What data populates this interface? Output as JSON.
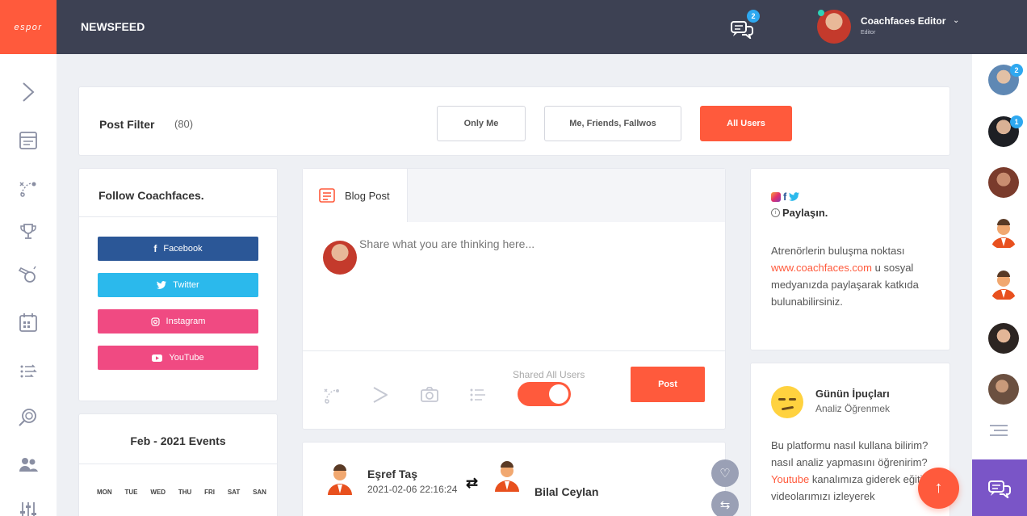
{
  "brand": {
    "logo_text": "espor",
    "accent": "#ff5a3c"
  },
  "header": {
    "title": "NEWSFEED",
    "messages_badge": "2",
    "user": {
      "name": "Coachfaces Editor",
      "role": "Editor"
    }
  },
  "left_nav": [
    "chevron-right-icon",
    "newsfeed-icon",
    "tactics-icon",
    "trophy-icon",
    "whistle-icon",
    "calendar-icon",
    "drills-icon",
    "analysis-icon",
    "team-icon",
    "settings-sliders-icon"
  ],
  "right_sidebar": {
    "badges": [
      "2",
      "1"
    ]
  },
  "post_filter": {
    "label": "Post Filter",
    "count": "(80)",
    "options": [
      "Only Me",
      "Me, Friends, Fallwos",
      "All Users"
    ],
    "active": "All Users"
  },
  "follow": {
    "title": "Follow Coachfaces.",
    "buttons": [
      {
        "label": "Facebook",
        "color": "#2b5797"
      },
      {
        "label": "Twitter",
        "color": "#2bb9ec"
      },
      {
        "label": "Instagram",
        "color": "#f04a82"
      },
      {
        "label": "YouTube",
        "color": "#f04a82"
      }
    ]
  },
  "events": {
    "title": "Feb - 2021 Events",
    "days": [
      "MON",
      "TUE",
      "WED",
      "THU",
      "FRI",
      "SAT",
      "SAN"
    ]
  },
  "composer": {
    "tab_label": "Blog Post",
    "placeholder": "Share what you are thinking here...",
    "shared_label": "Shared All Users",
    "post_button": "Post"
  },
  "feed_post": {
    "author": "Eşref Taş",
    "date": "2021-02-06 22:16:24",
    "target": "Bilal Ceylan"
  },
  "share_card": {
    "title": "Paylaşın.",
    "text_before": "Atrenörlerin buluşma noktası",
    "link": "www.coachfaces.com",
    "text_after": "u sosyal medyanızda paylaşarak katkıda bulunabilirsiniz."
  },
  "tip_card": {
    "title": "Günün İpuçları",
    "subtitle": "Analiz Öğrenmek",
    "text": "Bu platformu nasıl kullana bilirim? nasıl analiz yapmasını öğrenirim?",
    "link": "Youtube",
    "text_after": "kanalımıza giderek eğitim videolarımızı izleyerek"
  }
}
